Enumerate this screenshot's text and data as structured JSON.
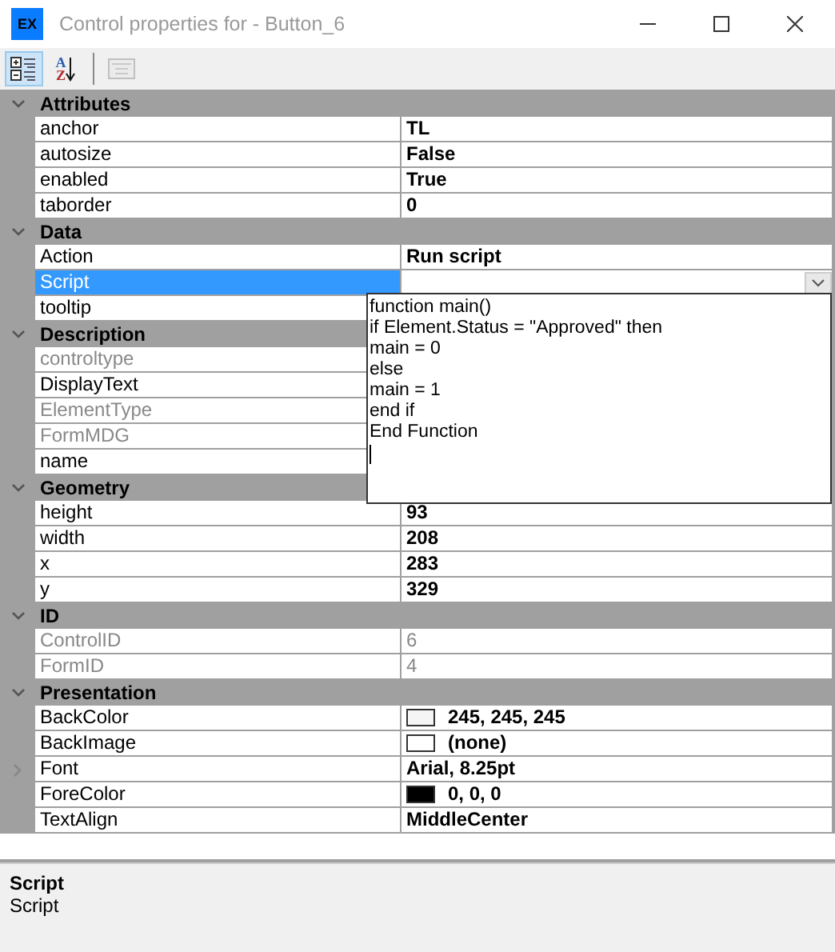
{
  "window": {
    "app_icon": "EX",
    "title": "Control properties for  - Button_6"
  },
  "toolbar": [
    {
      "kind": "categorized",
      "selected": true
    },
    {
      "kind": "alphabetical",
      "selected": false,
      "letters": [
        "A",
        "Z"
      ]
    },
    {
      "kind": "pages",
      "selected": false,
      "disabled": true
    }
  ],
  "categories": [
    {
      "name": "Attributes",
      "expanded": true,
      "properties": [
        {
          "name": "anchor",
          "value": "TL",
          "disabled": false,
          "selected": false
        },
        {
          "name": "autosize",
          "value": "False",
          "disabled": false,
          "selected": false
        },
        {
          "name": "enabled",
          "value": "True",
          "disabled": false,
          "selected": false
        },
        {
          "name": "taborder",
          "value": "0",
          "disabled": false,
          "selected": false
        }
      ]
    },
    {
      "name": "Data",
      "expanded": true,
      "properties": [
        {
          "name": "Action",
          "value": "Run script",
          "disabled": false,
          "selected": false
        },
        {
          "name": "Script",
          "disabled": false,
          "selected": true
        },
        {
          "name": "tooltip",
          "disabled": false,
          "selected": false
        }
      ]
    },
    {
      "name": "Description",
      "expanded": true,
      "properties": [
        {
          "name": "controltype",
          "disabled": true,
          "selected": false
        },
        {
          "name": "DisplayText",
          "disabled": false,
          "selected": false
        },
        {
          "name": "ElementType",
          "disabled": true,
          "selected": false
        },
        {
          "name": "FormMDG",
          "disabled": true,
          "selected": false
        },
        {
          "name": "name",
          "disabled": false,
          "selected": false
        }
      ]
    },
    {
      "name": "Geometry",
      "expanded": true,
      "properties": [
        {
          "name": "height",
          "value": "93",
          "disabled": false,
          "selected": false
        },
        {
          "name": "width",
          "value": "208",
          "disabled": false,
          "selected": false
        },
        {
          "name": "x",
          "value": "283",
          "disabled": false,
          "selected": false
        },
        {
          "name": "y",
          "value": "329",
          "disabled": false,
          "selected": false
        }
      ]
    },
    {
      "name": "ID",
      "expanded": true,
      "properties": [
        {
          "name": "ControlID",
          "value": "6",
          "disabled": true,
          "selected": false
        },
        {
          "name": "FormID",
          "value": "4",
          "disabled": true,
          "selected": false
        }
      ]
    },
    {
      "name": "Presentation",
      "expanded": true,
      "properties": [
        {
          "name": "BackColor",
          "value": "245, 245, 245",
          "color": "#f5f5f5",
          "disabled": false,
          "selected": false
        },
        {
          "name": "BackImage",
          "value": "(none)",
          "color": "#ffffff",
          "disabled": false,
          "selected": false
        },
        {
          "name": "Font",
          "value": "Arial, 8.25pt",
          "disabled": false,
          "selected": false,
          "expandable": true
        },
        {
          "name": "ForeColor",
          "value": "0, 0, 0",
          "color": "#000000",
          "disabled": false,
          "selected": false
        },
        {
          "name": "TextAlign",
          "value": "MiddleCenter",
          "disabled": false,
          "selected": false
        }
      ]
    }
  ],
  "script_editor": {
    "lines": [
      "function main()",
      "if Element.Status = \"Approved\" then",
      "main = 0",
      "else",
      "main = 1",
      "end if",
      "End Function"
    ]
  },
  "help": {
    "title": "Script",
    "description": "Script"
  }
}
